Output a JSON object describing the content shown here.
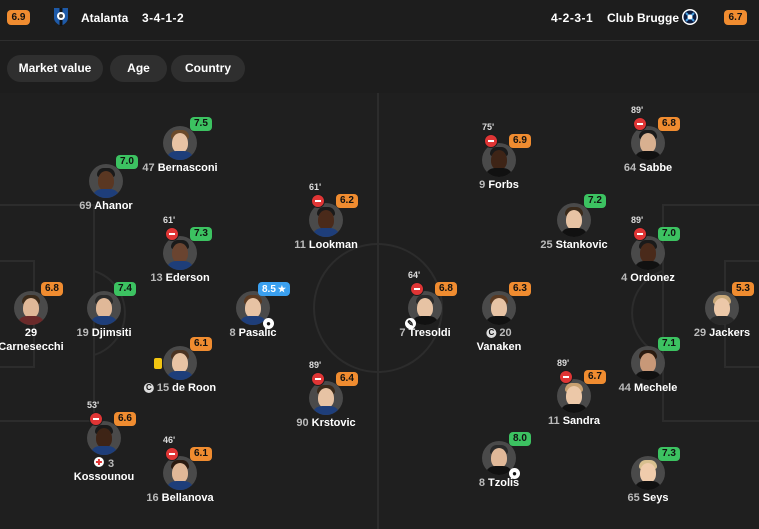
{
  "home": {
    "rating": "6.9",
    "name": "Atalanta",
    "formation": "3-4-1-2"
  },
  "away": {
    "rating": "6.7",
    "name": "Club Brugge",
    "formation": "4-2-3-1"
  },
  "tabs": [
    "Market value",
    "Age",
    "Country"
  ],
  "colors": {
    "rating_green": "#3cc261",
    "rating_orange": "#f08c30",
    "rating_blue": "#3aa0f0",
    "sub_red": "#e03535",
    "pitch": "#1f1f1f"
  },
  "players": [
    {
      "id": "bernasconi",
      "rating": "7.5",
      "rating_color": "green",
      "number": "47",
      "name": "Bernasconi"
    },
    {
      "id": "ahanor",
      "rating": "7.0",
      "rating_color": "green",
      "number": "69",
      "name": "Ahanor"
    },
    {
      "id": "lookman",
      "rating": "6.2",
      "rating_color": "orange",
      "number": "11",
      "name": "Lookman",
      "sub_time": "61'"
    },
    {
      "id": "ederson",
      "rating": "7.3",
      "rating_color": "green",
      "number": "13",
      "name": "Ederson",
      "sub_time": "61'"
    },
    {
      "id": "carnesecchi",
      "rating": "6.8",
      "rating_color": "orange",
      "number": "29",
      "name": "Carnesecchi"
    },
    {
      "id": "djimsiti",
      "rating": "7.4",
      "rating_color": "green",
      "number": "19",
      "name": "Djimsiti"
    },
    {
      "id": "pasalic",
      "rating": "8.5",
      "rating_color": "blue",
      "star": "★",
      "number": "8",
      "name": "Pasalic"
    },
    {
      "id": "deroon",
      "rating": "6.1",
      "rating_color": "orange",
      "number": "15",
      "name": "de Roon",
      "captain": "C"
    },
    {
      "id": "krstovic",
      "rating": "6.4",
      "rating_color": "orange",
      "number": "90",
      "name": "Krstovic",
      "sub_time": "89'"
    },
    {
      "id": "kossounou",
      "rating": "6.6",
      "rating_color": "orange",
      "number": "3",
      "name": "Kossounou",
      "sub_time": "53'"
    },
    {
      "id": "bellanova",
      "rating": "6.1",
      "rating_color": "orange",
      "number": "16",
      "name": "Bellanova",
      "sub_time": "46'"
    },
    {
      "id": "forbs",
      "rating": "6.9",
      "rating_color": "orange",
      "number": "9",
      "name": "Forbs",
      "sub_time": "75'"
    },
    {
      "id": "sabbe",
      "rating": "6.8",
      "rating_color": "orange",
      "number": "64",
      "name": "Sabbe",
      "sub_time": "89'"
    },
    {
      "id": "stankovic",
      "rating": "7.2",
      "rating_color": "green",
      "number": "25",
      "name": "Stankovic"
    },
    {
      "id": "ordonez",
      "rating": "7.0",
      "rating_color": "green",
      "number": "4",
      "name": "Ordonez",
      "sub_time": "89'"
    },
    {
      "id": "tresoldi",
      "rating": "6.8",
      "rating_color": "orange",
      "number": "7",
      "name": "Tresoldi",
      "sub_time": "64'"
    },
    {
      "id": "vanaken",
      "rating": "6.3",
      "rating_color": "orange",
      "number": "20",
      "name": "Vanaken",
      "captain": "C"
    },
    {
      "id": "jackers",
      "rating": "5.3",
      "rating_color": "orange",
      "number": "29",
      "name": "Jackers"
    },
    {
      "id": "mechele",
      "rating": "7.1",
      "rating_color": "green",
      "number": "44",
      "name": "Mechele"
    },
    {
      "id": "sandra",
      "rating": "6.7",
      "rating_color": "orange",
      "number": "11",
      "name": "Sandra",
      "sub_time": "89'"
    },
    {
      "id": "tzolis",
      "rating": "8.0",
      "rating_color": "green",
      "number": "8",
      "name": "Tzolis"
    },
    {
      "id": "seys",
      "rating": "7.3",
      "rating_color": "green",
      "number": "65",
      "name": "Seys"
    }
  ]
}
